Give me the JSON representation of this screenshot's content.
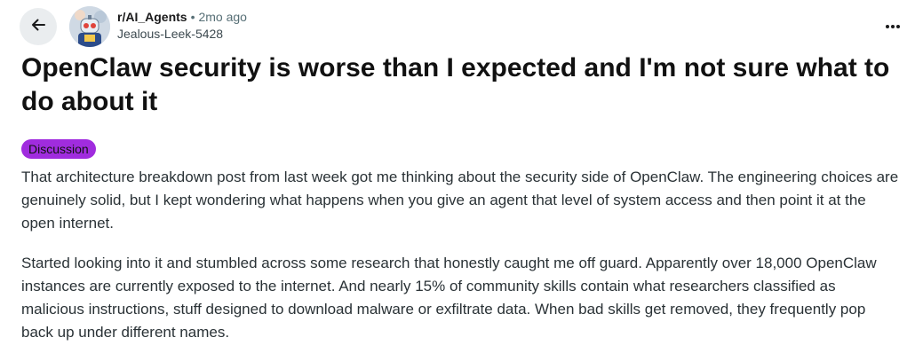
{
  "post": {
    "subreddit": "r/AI_Agents",
    "separator": "•",
    "age": "2mo ago",
    "author": "Jealous-Leek-5428",
    "title": "OpenClaw security is worse than I expected and I'm not sure what to do about it",
    "flair": "Discussion",
    "paragraphs": [
      "That architecture breakdown post from last week got me thinking about the security side of OpenClaw. The engineering choices are genuinely solid, but I kept wondering what happens when you give an agent that level of system access and then point it at the open internet.",
      "Started looking into it and stumbled across some research that honestly caught me off guard. Apparently over 18,000 OpenClaw instances are currently exposed to the internet. And nearly 15% of community skills contain what researchers classified as malicious instructions, stuff designed to download malware or exfiltrate data. When bad skills get removed, they frequently pop back up under different names."
    ]
  },
  "icons": {
    "back": "arrow-left-icon",
    "more": "more-horizontal-icon",
    "avatar": "subreddit-robot-avatar"
  },
  "colors": {
    "flair_background": "#a02cde",
    "back_button_background": "#eaedef"
  }
}
